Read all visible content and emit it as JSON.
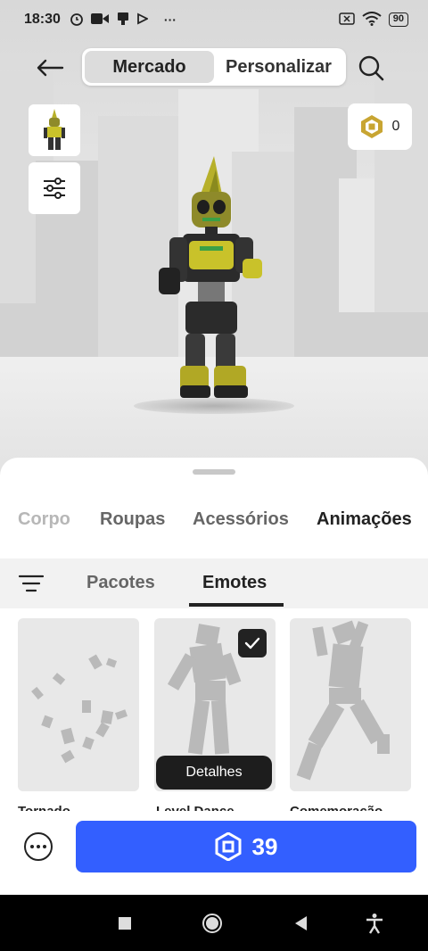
{
  "status_bar": {
    "time": "18:30",
    "left_icons": [
      "alarm-icon",
      "video-icon",
      "game-controller-icon",
      "play-icon"
    ],
    "more": "···",
    "battery": "90"
  },
  "top_nav": {
    "tabs": [
      {
        "label": "Mercado",
        "active": true
      },
      {
        "label": "Personalizar",
        "active": false
      }
    ]
  },
  "robux_balance": "0",
  "category_tabs": [
    {
      "label": "Corpo",
      "active": false
    },
    {
      "label": "Roupas",
      "active": false
    },
    {
      "label": "Acessórios",
      "active": false
    },
    {
      "label": "Animações",
      "active": true
    }
  ],
  "sub_tabs": [
    {
      "label": "Pacotes",
      "active": false
    },
    {
      "label": "Emotes",
      "active": true
    }
  ],
  "items": [
    {
      "name": "Tornado",
      "selected": false
    },
    {
      "name": "Level Dance",
      "selected": true
    },
    {
      "name": "Comemoração",
      "selected": false
    }
  ],
  "details_tooltip": "Detalhes",
  "buy_button": {
    "price": "39"
  },
  "colors": {
    "accent": "#335fff",
    "selected_check": "#222222"
  }
}
